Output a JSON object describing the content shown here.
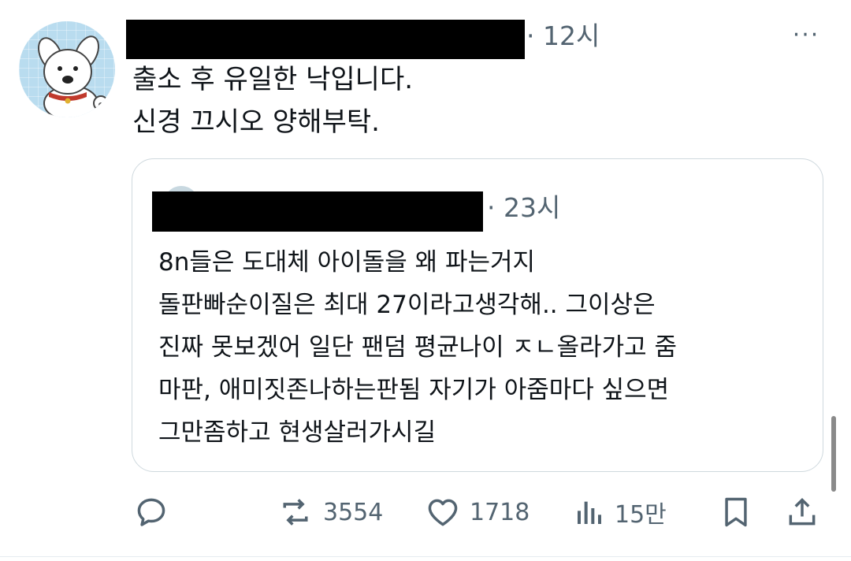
{
  "tweet": {
    "timestamp": "· 12시",
    "more_label": "···",
    "text": "출소 후 유일한 낙입니다.\n신경 끄시오 양해부탁."
  },
  "quoted": {
    "timestamp": "· 23시",
    "text": "8n들은 도대체 아이돌을 왜 파는거지\n돌판빠순이질은 최대 27이라고생각해.. 그이상은\n진짜 못보겠어 일단 팬덤 평균나이 ㅈㄴ올라가고 줌\n마판, 애미짓존나하는판됨 자기가 아줌마다 싶으면\n그만좀하고 현생살러가시길"
  },
  "actions": {
    "reply_icon": "reply-icon",
    "retweet_icon": "retweet-icon",
    "retweets": "3554",
    "like_icon": "heart-icon",
    "likes": "1718",
    "views_icon": "views-icon",
    "views": "15만",
    "bookmark_icon": "bookmark-icon",
    "share_icon": "share-icon"
  },
  "colors": {
    "text": "#0f1419",
    "secondary": "#536471",
    "border": "#cfd9de",
    "avatar_bg": "#b9dcef"
  }
}
